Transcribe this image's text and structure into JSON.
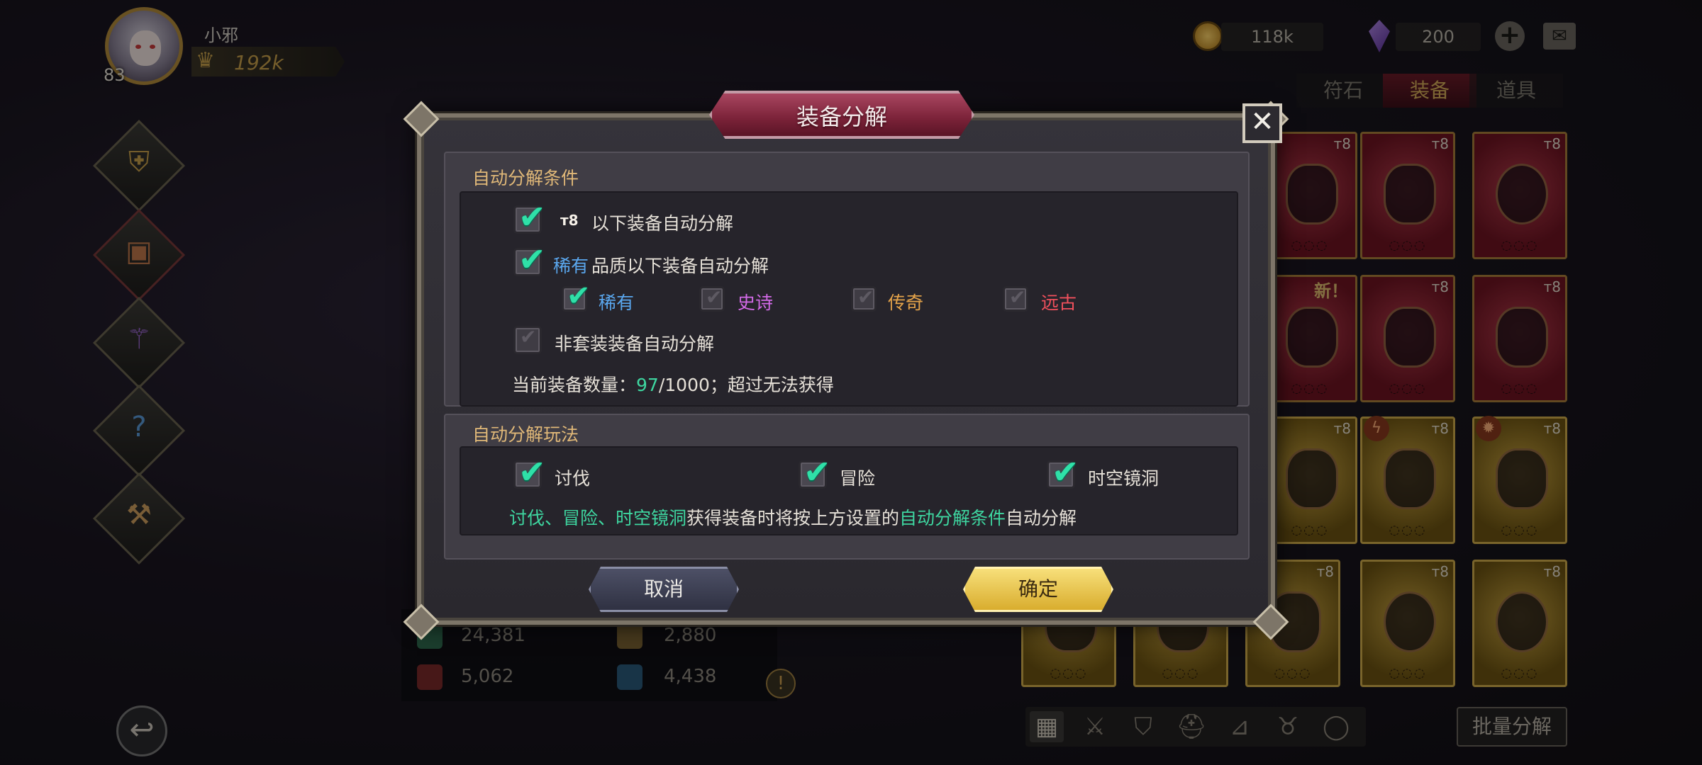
{
  "player": {
    "name": "小邪",
    "level": "83",
    "power": "192k"
  },
  "currency": {
    "gold": "118k",
    "gems": "200"
  },
  "tabs": [
    {
      "label": "符石",
      "active": false
    },
    {
      "label": "装备",
      "active": true
    },
    {
      "label": "道具",
      "active": false
    }
  ],
  "inventory": {
    "tier_label": "т8",
    "new_label": "新！",
    "rows": [
      [
        "red",
        "red",
        "red"
      ],
      [
        "red",
        "red",
        "red"
      ],
      [
        "gold",
        "gold",
        "gold"
      ],
      [
        "gold",
        "gold",
        "gold",
        "gold",
        "gold"
      ]
    ]
  },
  "stats": {
    "left_top": "24,381",
    "right_top": "2,880",
    "left_bottom": "5,062",
    "right_bottom": "4,438"
  },
  "bottom": {
    "batch_label": "批量分解"
  },
  "modal": {
    "title": "装备分解",
    "close_icon": "✕",
    "section1": {
      "title": "自动分解条件",
      "opt_tier": {
        "tier": "т8",
        "text": "以下装备自动分解",
        "checked": true
      },
      "opt_quality": {
        "quality": "稀有",
        "text": "品质以下装备自动分解",
        "checked": true
      },
      "qualities": [
        {
          "label": "稀有",
          "checked": true,
          "color": "#5aa7ee"
        },
        {
          "label": "史诗",
          "checked": false,
          "color": "#d36ae8"
        },
        {
          "label": "传奇",
          "checked": false,
          "color": "#e6a44a"
        },
        {
          "label": "远古",
          "checked": false,
          "color": "#f0505c"
        }
      ],
      "opt_nonset": {
        "text": "非套装装备自动分解",
        "checked": false
      },
      "count_prefix": "当前装备数量：",
      "count_current": "97",
      "count_suffix": "/1000；超过无法获得"
    },
    "section2": {
      "title": "自动分解玩法",
      "modes": [
        {
          "label": "讨伐",
          "checked": true
        },
        {
          "label": "冒险",
          "checked": true
        },
        {
          "label": "时空镜洞",
          "checked": true
        }
      ],
      "note_modes": "讨伐、冒险、时空镜洞",
      "note_mid": "获得装备时将按上方设置的",
      "note_link": "自动分解条件",
      "note_end": "自动分解"
    },
    "cancel_label": "取消",
    "confirm_label": "确定"
  }
}
